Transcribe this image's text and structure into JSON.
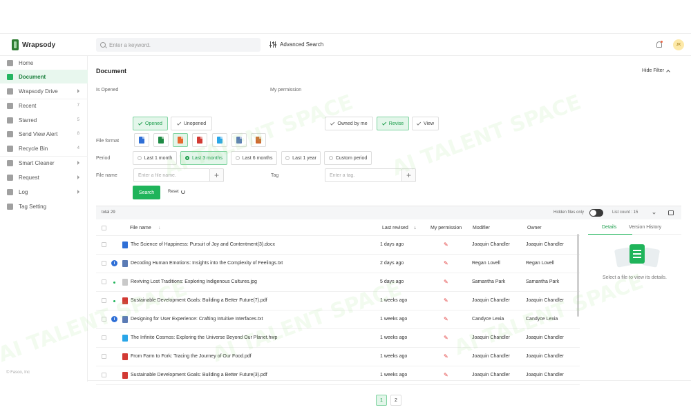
{
  "app": {
    "name": "Wrapsody"
  },
  "header": {
    "search_placeholder": "Enter a keyword.",
    "advanced_search": "Advanced Search",
    "avatar_initials": "JK"
  },
  "sidebar": {
    "items": [
      {
        "label": "Home",
        "count": ""
      },
      {
        "label": "Document",
        "count": ""
      },
      {
        "label": "Wrapsody Drive",
        "count": ""
      },
      {
        "label": "Recent",
        "count": "7"
      },
      {
        "label": "Starred",
        "count": "5"
      },
      {
        "label": "Send View Alert",
        "count": "8"
      },
      {
        "label": "Recycle Bin",
        "count": "4"
      },
      {
        "label": "Smart Cleaner",
        "count": ""
      },
      {
        "label": "Request",
        "count": ""
      },
      {
        "label": "Log",
        "count": ""
      },
      {
        "label": "Tag Setting",
        "count": ""
      }
    ],
    "copyright": "© Fasoo, Inc"
  },
  "main": {
    "title": "Document",
    "hide_filter": "Hide Filter"
  },
  "filters": {
    "is_opened_label": "Is Opened",
    "is_opened_options": [
      "Opened",
      "Unopened"
    ],
    "permission_label": "My permission",
    "permission_options": [
      "Owned by me",
      "Revise",
      "View"
    ],
    "format_label": "File format",
    "formats": [
      "word-icon",
      "excel-icon",
      "powerpoint-icon",
      "pdf-icon",
      "hwp-icon",
      "txt-icon",
      "image-icon"
    ],
    "period_label": "Period",
    "period_options": [
      "Last 1 month",
      "Last 3 months",
      "Last 6 months",
      "Last 1 year",
      "Custom period"
    ],
    "filename_label": "File name",
    "filename_placeholder": "Enter a file name.",
    "tag_label": "Tag",
    "tag_placeholder": "Enter a tag.",
    "search_button": "Search",
    "reset_button": "Reset"
  },
  "table_bar": {
    "total": "total 29",
    "hidden_files": "Hidden files only",
    "list_count": "List count :  15"
  },
  "table": {
    "headers": {
      "name": "File name",
      "revised": "Last revised",
      "permission": "My permission",
      "modifier": "Modifier",
      "owner": "Owner"
    },
    "rows": [
      {
        "name": "The Science of Happiness: Pursuit of Joy and Contentment(3).docx",
        "revised": "1 days ago",
        "modifier": "Joaquin Chandler",
        "owner": "Joaquin Chandler"
      },
      {
        "name": "Decoding Human Emotions: Insights into the Complexity of Feelings.txt",
        "revised": "2 days ago",
        "modifier": "Regan Lovell",
        "owner": "Regan Lovell"
      },
      {
        "name": "Reviving Lost Traditions: Exploring Indigenous Cultures.jpg",
        "revised": "5 days ago",
        "modifier": "Samantha Park",
        "owner": "Samantha Park"
      },
      {
        "name": "Sustainable Development Goals: Building a Better Future(7).pdf",
        "revised": "1 weeks ago",
        "modifier": "Joaquin Chandler",
        "owner": "Joaquin Chandler"
      },
      {
        "name": "Designing for User Experience: Crafting Intuitive Interfaces.txt",
        "revised": "1 weeks ago",
        "modifier": "Candyce Lexia",
        "owner": "Candyce Lexia"
      },
      {
        "name": "The Infinite Cosmos: Exploring the Universe Beyond Our Planet.hwp",
        "revised": "1 weeks ago",
        "modifier": "Joaquin Chandler",
        "owner": "Joaquin Chandler"
      },
      {
        "name": "From Farm to Fork: Tracing the Journey of Our Food.pdf",
        "revised": "1 weeks ago",
        "modifier": "Joaquin Chandler",
        "owner": "Joaquin Chandler"
      },
      {
        "name": "Sustainable Development Goals: Building a Better Future(3).pdf",
        "revised": "1 weeks ago",
        "modifier": "Joaquin Chandler",
        "owner": "Joaquin Chandler"
      }
    ]
  },
  "details": {
    "tabs": [
      "Details",
      "Version History"
    ],
    "empty_text": "Select a file to view its details."
  },
  "pagination": {
    "pages": [
      "1",
      "2"
    ]
  },
  "watermark": {
    "text": "AI TALENT SPACE"
  },
  "colors": {
    "accent": "#1fb45a",
    "word": "#2f6fd6",
    "excel": "#1e8a45",
    "ppt": "#e8682f",
    "pdf": "#d23a34",
    "hwp": "#2aa6e8",
    "txt": "#5b7bb5",
    "image": "#cf6a2f"
  }
}
